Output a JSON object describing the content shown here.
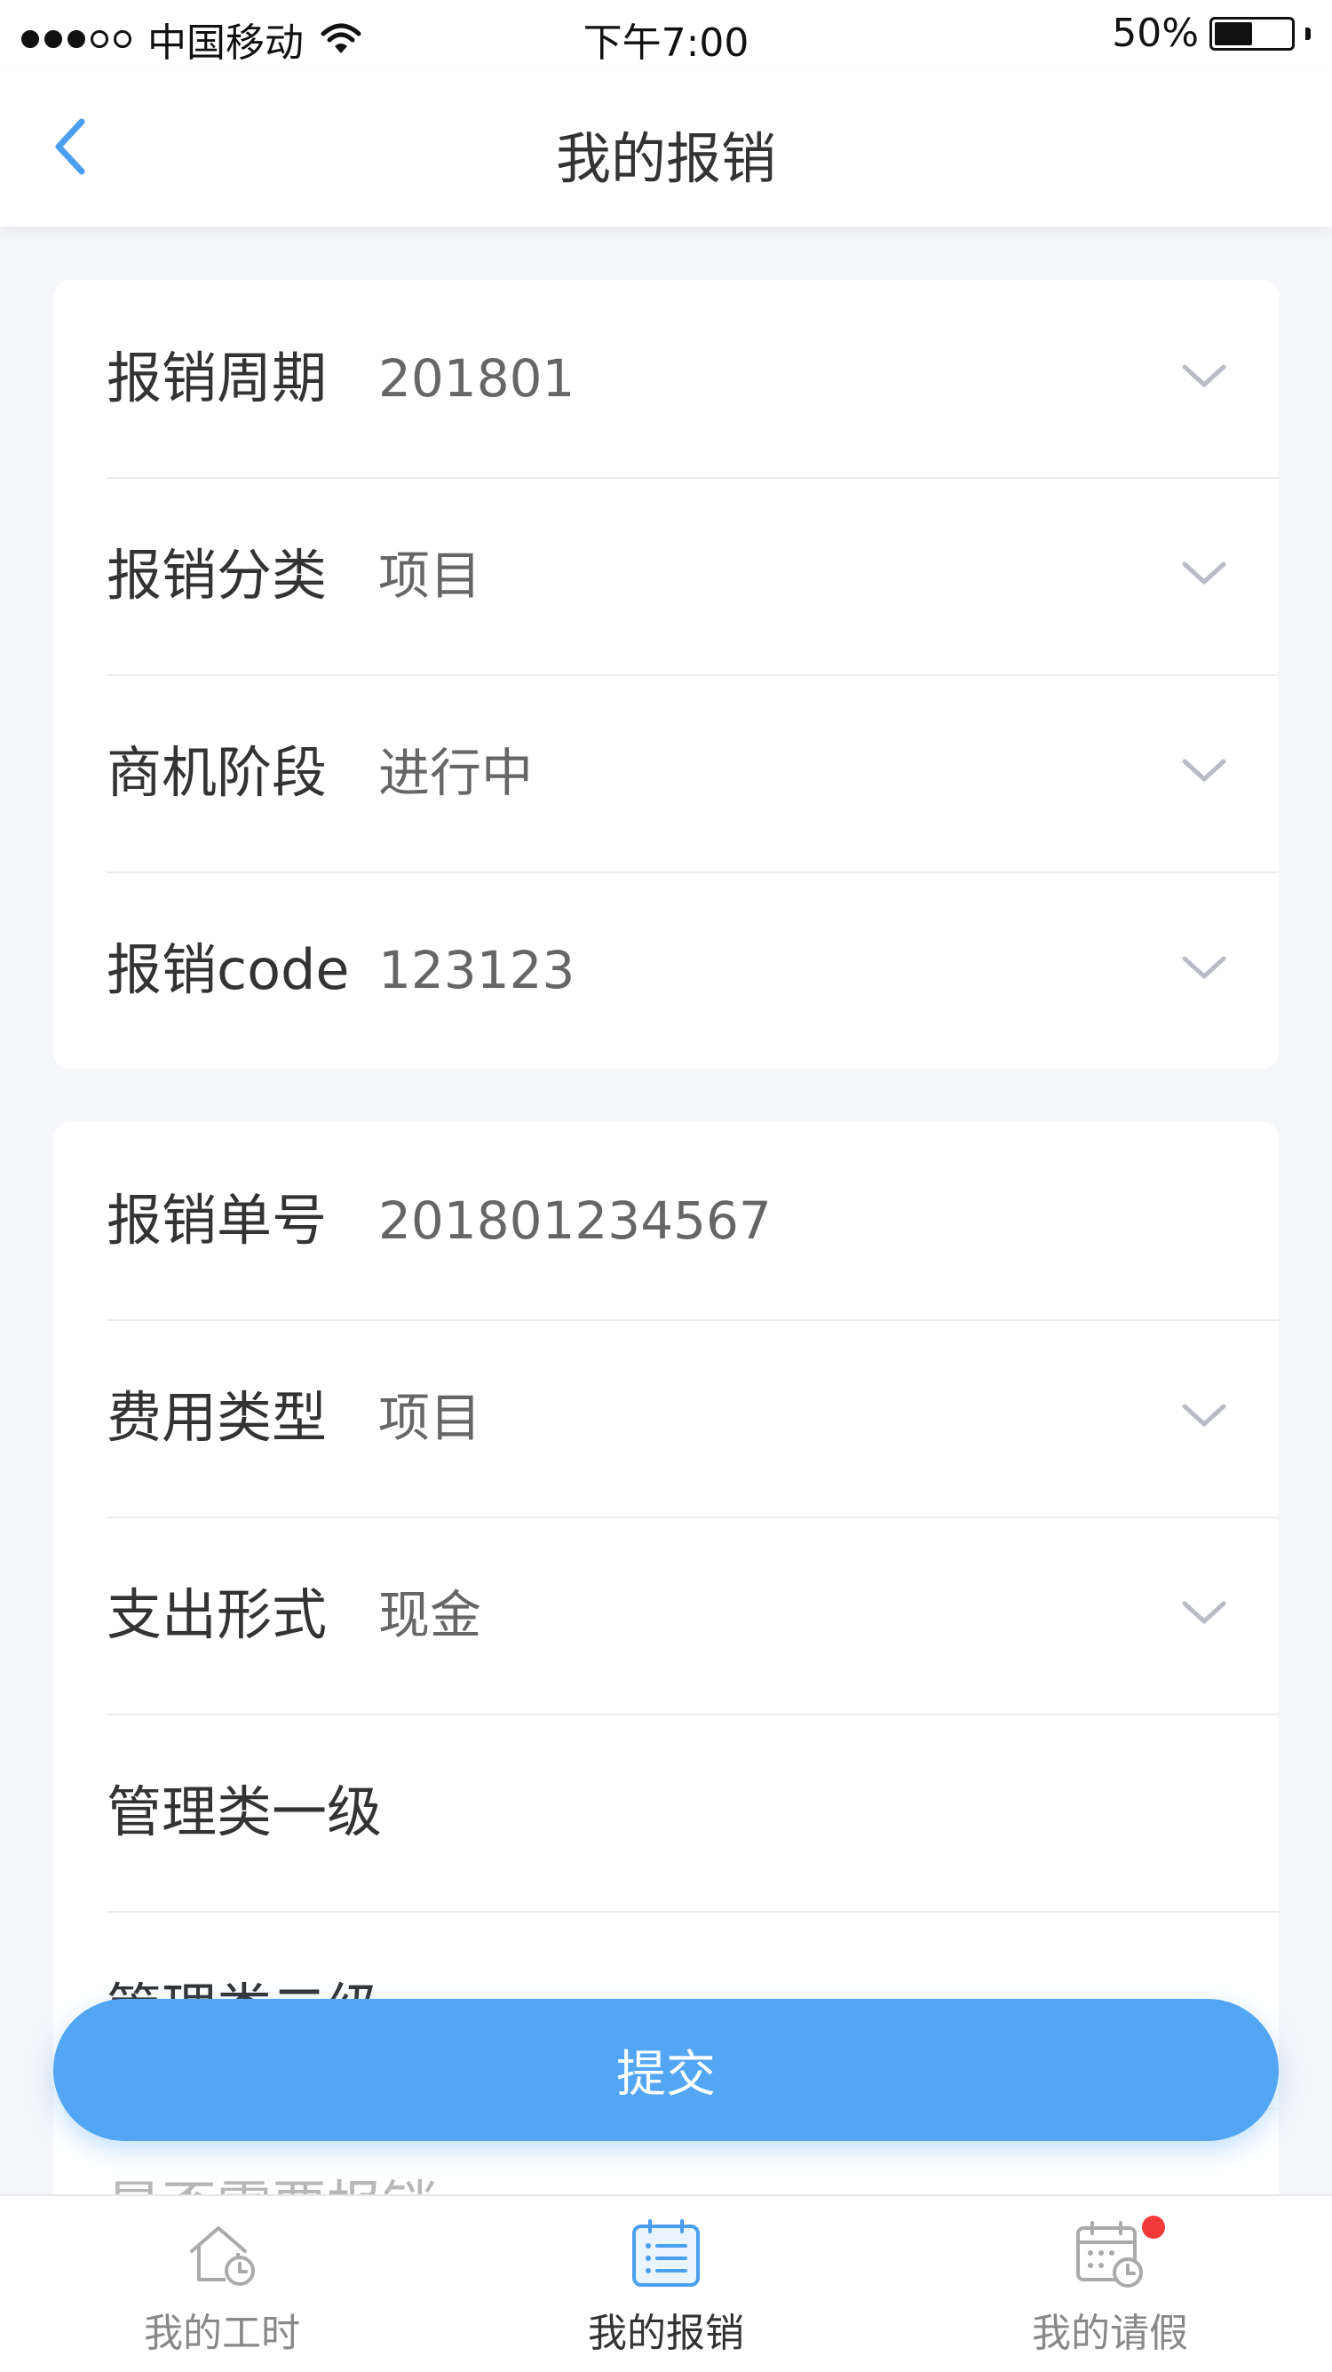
{
  "status_bar": {
    "carrier": "中国移动",
    "time": "下午7:00",
    "battery": "50%",
    "battery_level": 0.5
  },
  "nav": {
    "title": "我的报销"
  },
  "section1": {
    "rows": [
      {
        "label": "报销周期",
        "value": "201801",
        "icon": "chevron-down-icon"
      },
      {
        "label": "报销分类",
        "value": "项目",
        "icon": "chevron-down-icon"
      },
      {
        "label": "商机阶段",
        "value": "进行中",
        "icon": "chevron-down-icon"
      },
      {
        "label": "报销code",
        "value": "123123",
        "icon": "chevron-down-icon"
      }
    ]
  },
  "section2": {
    "rows": [
      {
        "label": "报销单号",
        "value": "201801234567"
      },
      {
        "label": "费用类型",
        "value": "项目",
        "icon": "chevron-down-icon"
      },
      {
        "label": "支出形式",
        "value": "现金",
        "icon": "chevron-down-icon"
      },
      {
        "label": "管理类一级",
        "value": ""
      },
      {
        "label": "管理类二级",
        "value": ""
      }
    ],
    "partial_below": "是否需要报销"
  },
  "submit_label": "提交",
  "tabs": [
    {
      "label": "我的工时",
      "icon": "home-clock-icon",
      "active": false
    },
    {
      "label": "我的报销",
      "icon": "list-icon",
      "active": true
    },
    {
      "label": "我的请假",
      "icon": "calendar-clock-icon",
      "active": false,
      "badge": true
    }
  ],
  "colors": {
    "accent": "#53a6f4",
    "badge": "#f23a3a"
  }
}
